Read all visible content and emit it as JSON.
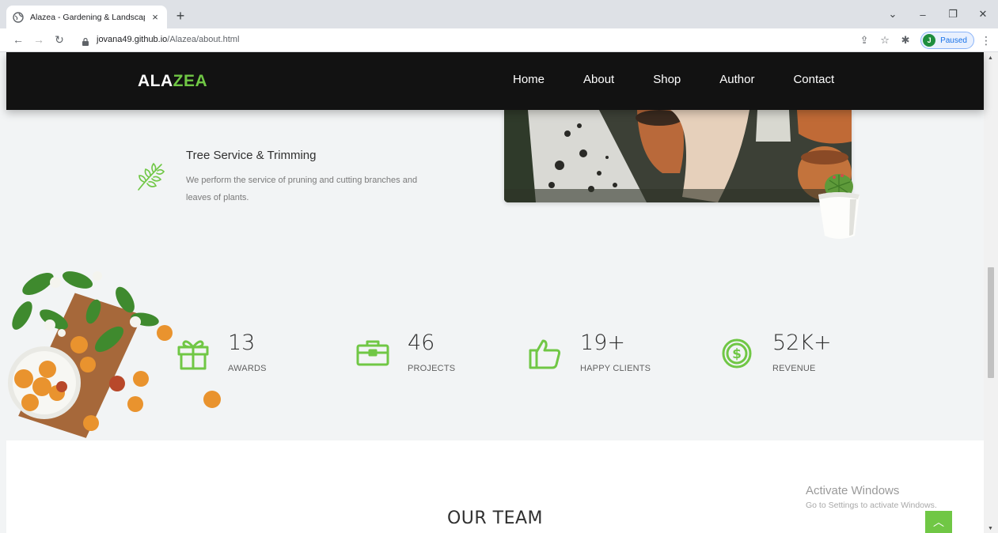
{
  "browser": {
    "tab_title": "Alazea - Gardening & Landscaping",
    "tab_close": "×",
    "new_tab": "+",
    "url_host": "jovana49.github.io",
    "url_path": "/Alazea/about.html",
    "profile_initial": "J",
    "profile_status": "Paused"
  },
  "site": {
    "logo_part1": "ALA",
    "logo_part2": "ZEA",
    "nav": [
      "Home",
      "About",
      "Shop",
      "Author",
      "Contact"
    ]
  },
  "service": {
    "title": "Tree Service & Trimming",
    "description": "We perform the service of pruning and cutting branches and leaves of plants."
  },
  "stats": [
    {
      "number": "13",
      "label": "AWARDS",
      "icon": "gift-icon"
    },
    {
      "number": "46",
      "label": "PROJECTS",
      "icon": "briefcase-icon"
    },
    {
      "number": "19+",
      "label": "HAPPY CLIENTS",
      "icon": "thumbs-up-icon"
    },
    {
      "number": "52K+",
      "label": "REVENUE",
      "icon": "dollar-icon"
    }
  ],
  "team": {
    "heading": "OUR TEAM"
  },
  "windows_notice": {
    "title": "Activate Windows",
    "subtitle": "Go to Settings to activate Windows."
  },
  "colors": {
    "accent": "#70c745",
    "nav_bg": "#121212",
    "section_bg": "#f2f4f5"
  }
}
